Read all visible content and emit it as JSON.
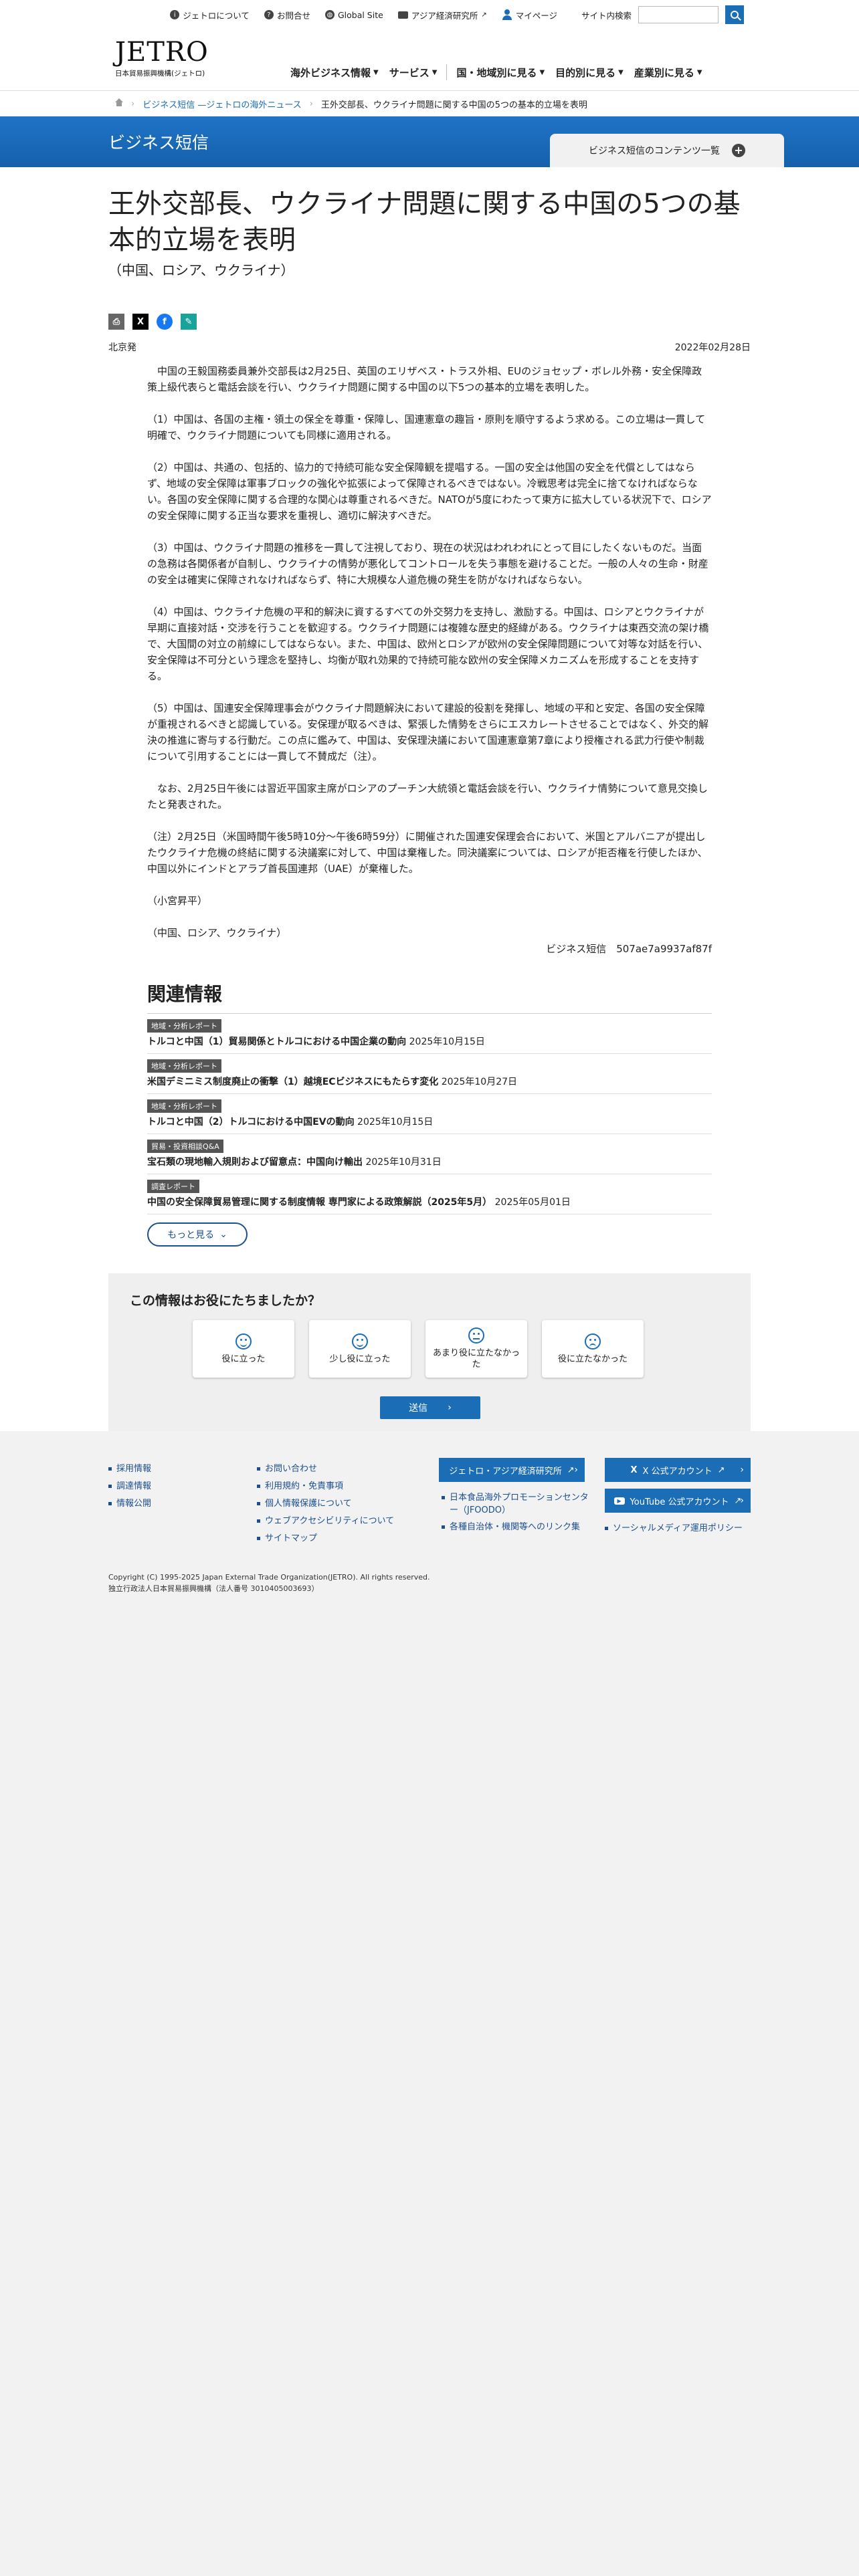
{
  "utility": {
    "about": "ジェトロについて",
    "contact": "お問合せ",
    "global": "Global Site",
    "ide": "アジア経済研究所",
    "mypage": "マイページ",
    "search_label": "サイト内検索"
  },
  "header": {
    "logo": "JETRO",
    "logo_sub": "日本貿易振興機構(ジェトロ)",
    "nav": [
      "海外ビジネス情報",
      "サービス",
      "国・地域別に見る",
      "目的別に見る",
      "産業別に見る"
    ]
  },
  "breadcrumb": {
    "section": "ビジネス短信 —ジェトロの海外ニュース",
    "current": "王外交部長、ウクライナ問題に関する中国の5つの基本的立場を表明"
  },
  "banner": {
    "title": "ビジネス短信",
    "contents": "ビジネス短信のコンテンツ一覧"
  },
  "article": {
    "title": "王外交部長、ウクライナ問題に関する中国の5つの基本的立場を表明",
    "subtitle": "（中国、ロシア、ウクライナ）",
    "location": "北京発",
    "date": "2022年02月28日",
    "paragraphs": [
      "中国の王毅国務委員兼外交部長は2月25日、英国のエリザベス・トラス外相、EUのジョセップ・ボレル外務・安全保障政策上級代表らと電話会談を行い、ウクライナ問題に関する中国の以下5つの基本的立場を表明した。",
      "（1）中国は、各国の主権・領土の保全を尊重・保障し、国連憲章の趣旨・原則を順守するよう求める。この立場は一貫して明確で、ウクライナ問題についても同様に適用される。",
      "（2）中国は、共通の、包括的、協力的で持続可能な安全保障観を提唱する。一国の安全は他国の安全を代償としてはならず、地域の安全保障は軍事ブロックの強化や拡張によって保障されるべきではない。冷戦思考は完全に捨てなければならない。各国の安全保障に関する合理的な関心は尊重されるべきだ。NATOが5度にわたって東方に拡大している状況下で、ロシアの安全保障に関する正当な要求を重視し、適切に解決すべきだ。",
      "（3）中国は、ウクライナ問題の推移を一貫して注視しており、現在の状況はわれわれにとって目にしたくないものだ。当面の急務は各関係者が自制し、ウクライナの情勢が悪化してコントロールを失う事態を避けることだ。一般の人々の生命・財産の安全は確実に保障されなければならず、特に大規模な人道危機の発生を防がなければならない。",
      "（4）中国は、ウクライナ危機の平和的解決に資するすべての外交努力を支持し、激励する。中国は、ロシアとウクライナが早期に直接対話・交渉を行うことを歓迎する。ウクライナ問題には複雑な歴史的経緯がある。ウクライナは東西交流の架け橋で、大国間の対立の前線にしてはならない。また、中国は、欧州とロシアが欧州の安全保障問題について対等な対話を行い、安全保障は不可分という理念を堅持し、均衡が取れ効果的で持続可能な欧州の安全保障メカニズムを形成することを支持する。",
      "（5）中国は、国連安全保障理事会がウクライナ問題解決において建設的役割を発揮し、地域の平和と安定、各国の安全保障が重視されるべきと認識している。安保理が取るべきは、緊張した情勢をさらにエスカレートさせることではなく、外交的解決の推進に寄与する行動だ。この点に鑑みて、中国は、安保理決議において国連憲章第7章により授権される武力行使や制裁について引用することには一貫して不賛成だ（注）。",
      "なお、2月25日午後には習近平国家主席がロシアのプーチン大統領と電話会談を行い、ウクライナ情勢について意見交換したと発表された。",
      "（注）2月25日（米国時間午後5時10分～午後6時59分）に開催された国連安保理会合において、米国とアルバニアが提出したウクライナ危機の終結に関する決議案に対して、中国は棄権した。同決議案については、ロシアが拒否権を行使したほか、中国以外にインドとアラブ首長国連邦（UAE）が棄権した。",
      "（小宮昇平）",
      "（中国、ロシア、ウクライナ）"
    ],
    "signature": "ビジネス短信　507ae7a9937af87f"
  },
  "related": {
    "heading": "関連情報",
    "items": [
      {
        "tag": "地域・分析レポート",
        "title": "トルコと中国（1）貿易関係とトルコにおける中国企業の動向",
        "date": "2025年10月15日"
      },
      {
        "tag": "地域・分析レポート",
        "title": "米国デミニミス制度廃止の衝撃（1）越境ECビジネスにもたらす変化",
        "date": "2025年10月27日"
      },
      {
        "tag": "地域・分析レポート",
        "title": "トルコと中国（2）トルコにおける中国EVの動向",
        "date": "2025年10月15日"
      },
      {
        "tag": "貿易・投資相談Q&A",
        "title": "宝石類の現地輸入規則および留意点：中国向け輸出",
        "date": "2025年10月31日"
      },
      {
        "tag": "調査レポート",
        "title": "中国の安全保障貿易管理に関する制度情報 専門家による政策解説（2025年5月）",
        "date": "2025年05月01日"
      }
    ],
    "more": "もっと見る"
  },
  "survey": {
    "question": "この情報はお役にたちましたか？",
    "options": [
      "役に立った",
      "少し役に立った",
      "あまり役に立たなかった",
      "役に立たなかった"
    ],
    "submit": "送信"
  },
  "footer": {
    "col1": [
      "採用情報",
      "調達情報",
      "情報公開"
    ],
    "col2": [
      "お問い合わせ",
      "利用規約・免責事項",
      "個人情報保護について",
      "ウェブアクセシビリティについて",
      "サイトマップ"
    ],
    "ide_banner": "ジェトロ・アジア経済研究所",
    "x_banner": "X 公式アカウント",
    "yt_banner": "YouTube 公式アカウント",
    "links_left": [
      "日本食品海外プロモーションセンター（JFOODO）",
      "各種自治体・機関等へのリンク集"
    ],
    "links_right": [
      "ソーシャルメディア運用ポリシー"
    ],
    "copyright": "Copyright (C) 1995-2025 Japan External Trade Organization(JETRO). All rights reserved.",
    "corp": "独立行政法人日本貿易振興機構（法人番号 3010405003693）"
  }
}
